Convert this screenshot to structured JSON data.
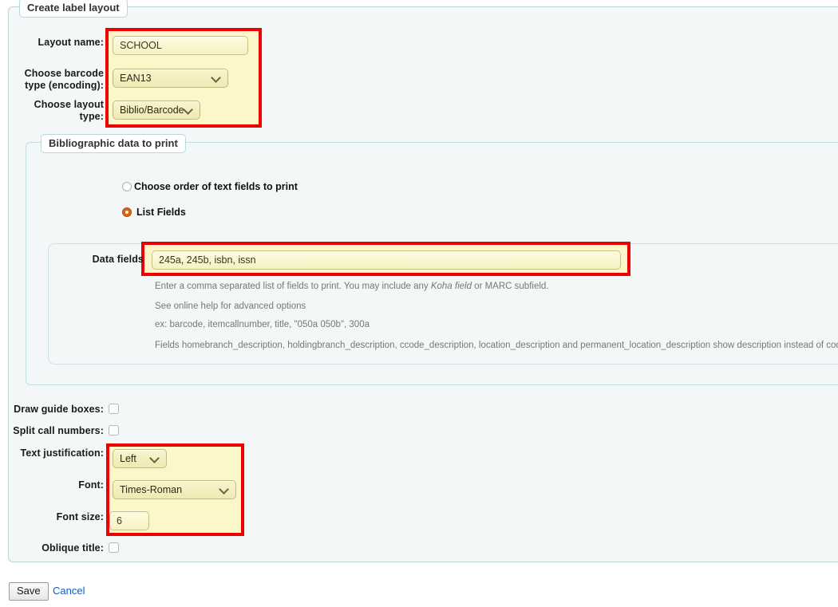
{
  "form": {
    "legend": "Create label layout",
    "layout_name": {
      "label": "Layout name:",
      "value": "SCHOOL"
    },
    "barcode_type": {
      "label_line1": "Choose barcode",
      "label_line2": "type (encoding):",
      "value": "EAN13"
    },
    "layout_type": {
      "label_line1": "Choose layout",
      "label_line2": "type:",
      "value": "Biblio/Barcode"
    }
  },
  "biblio": {
    "legend": "Bibliographic data to print",
    "radio_order": {
      "label": "Choose order of text fields to print",
      "checked": false
    },
    "radio_list": {
      "label": "List Fields",
      "checked": true
    },
    "data_fields": {
      "label": "Data fields",
      "value": "245a, 245b, isbn, issn"
    },
    "help": {
      "line1_a": "Enter a comma separated list of fields to print. You may include any ",
      "line1_em": "Koha field",
      "line1_b": " or MARC subfield.",
      "line2": "See online help for advanced options",
      "line3": "ex: barcode, itemcallnumber, title, \"050a 050b\", 300a",
      "line4": "Fields homebranch_description, holdingbranch_description, ccode_description, location_description and permanent_location_description show description instead of code."
    }
  },
  "options": {
    "draw_guide_boxes": {
      "label": "Draw guide boxes:",
      "checked": false
    },
    "split_call_numbers": {
      "label": "Split call numbers:",
      "checked": false
    },
    "text_justification": {
      "label": "Text justification:",
      "value": "Left"
    },
    "font": {
      "label": "Font:",
      "value": "Times-Roman"
    },
    "font_size": {
      "label": "Font size:",
      "value": "6"
    },
    "oblique_title": {
      "label": "Oblique title:",
      "checked": false
    }
  },
  "actions": {
    "save_label": "Save",
    "cancel_label": "Cancel"
  },
  "colors": {
    "highlight": "#ee0000",
    "field_background": "#fbf7c9",
    "panel_background": "#f3f7f8",
    "radio_accent": "#e1600f",
    "link": "#0a5ecc"
  }
}
